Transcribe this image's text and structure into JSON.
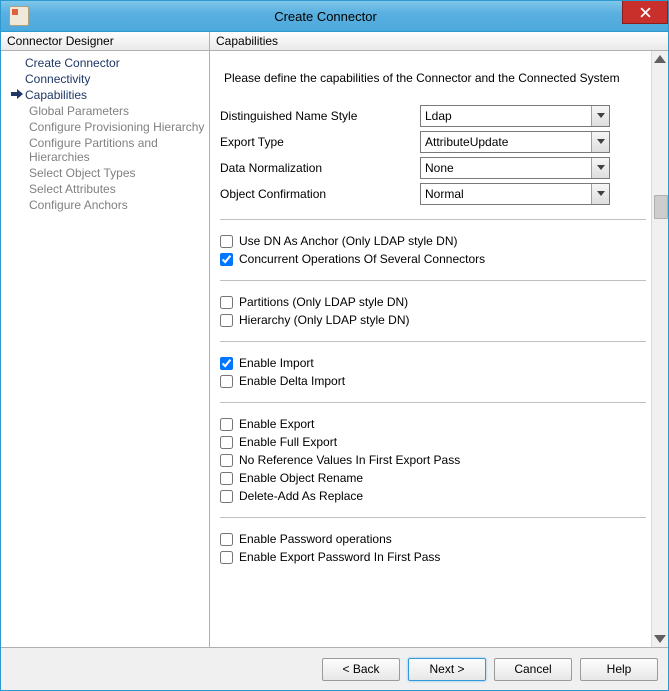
{
  "window": {
    "title": "Create Connector"
  },
  "sidebar": {
    "header": "Connector Designer",
    "items": [
      {
        "label": "Create Connector",
        "sub": false,
        "current": false
      },
      {
        "label": "Connectivity",
        "sub": false,
        "current": false
      },
      {
        "label": "Capabilities",
        "sub": false,
        "current": true
      },
      {
        "label": "Global Parameters",
        "sub": true,
        "current": false
      },
      {
        "label": "Configure Provisioning Hierarchy",
        "sub": true,
        "current": false
      },
      {
        "label": "Configure Partitions and Hierarchies",
        "sub": true,
        "current": false
      },
      {
        "label": "Select Object Types",
        "sub": true,
        "current": false
      },
      {
        "label": "Select Attributes",
        "sub": true,
        "current": false
      },
      {
        "label": "Configure Anchors",
        "sub": true,
        "current": false
      }
    ]
  },
  "main": {
    "header": "Capabilities",
    "instruction": "Please define the capabilities of the Connector and the Connected System",
    "dropdowns": [
      {
        "label": "Distinguished Name Style",
        "value": "Ldap"
      },
      {
        "label": "Export Type",
        "value": "AttributeUpdate"
      },
      {
        "label": "Data Normalization",
        "value": "None"
      },
      {
        "label": "Object Confirmation",
        "value": "Normal"
      }
    ],
    "groups": [
      [
        {
          "label": "Use DN As Anchor (Only LDAP style DN)",
          "checked": false
        },
        {
          "label": "Concurrent Operations Of Several Connectors",
          "checked": true
        }
      ],
      [
        {
          "label": "Partitions (Only LDAP style DN)",
          "checked": false
        },
        {
          "label": "Hierarchy (Only LDAP style DN)",
          "checked": false
        }
      ],
      [
        {
          "label": "Enable Import",
          "checked": true
        },
        {
          "label": "Enable Delta Import",
          "checked": false
        }
      ],
      [
        {
          "label": "Enable Export",
          "checked": false
        },
        {
          "label": "Enable Full Export",
          "checked": false
        },
        {
          "label": "No Reference Values In First Export Pass",
          "checked": false
        },
        {
          "label": "Enable Object Rename",
          "checked": false
        },
        {
          "label": "Delete-Add As Replace",
          "checked": false
        }
      ],
      [
        {
          "label": "Enable Password operations",
          "checked": false
        },
        {
          "label": "Enable Export Password In First Pass",
          "checked": false
        }
      ]
    ]
  },
  "footer": {
    "back": "<  Back",
    "next": "Next  >",
    "cancel": "Cancel",
    "help": "Help"
  }
}
